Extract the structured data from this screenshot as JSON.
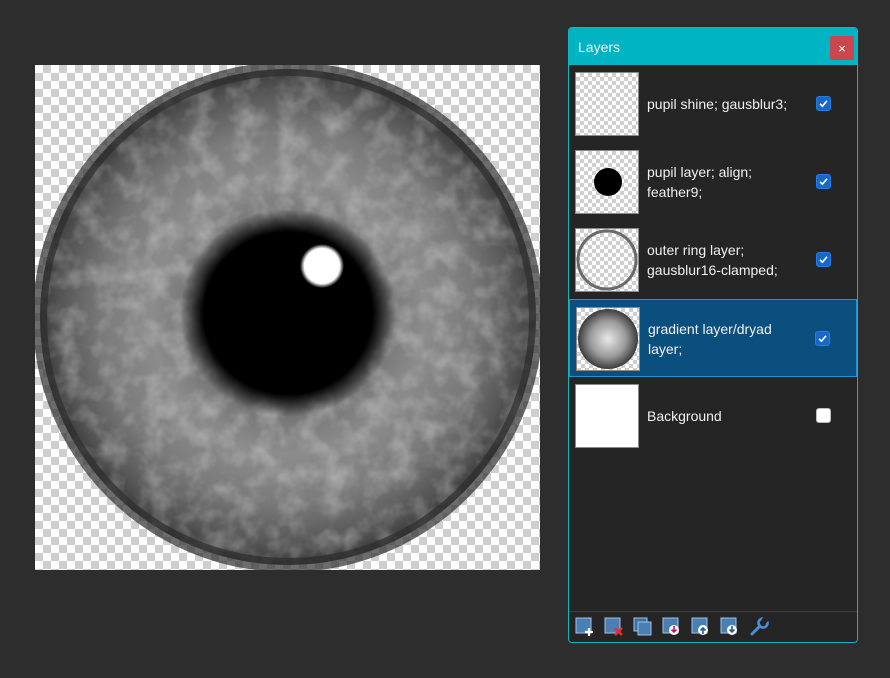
{
  "panel": {
    "title": "Layers",
    "close_glyph": "×",
    "accent_color": "#00b4c4",
    "selected_color": "#0b4f7f"
  },
  "layers": [
    {
      "label": "pupil shine; gausblur3;",
      "visible": true,
      "thumb": "transparent-shine"
    },
    {
      "label": "pupil layer; align; feather9;",
      "visible": true,
      "thumb": "pupil-dot"
    },
    {
      "label": "outer ring layer; gausblur16-clamped;",
      "visible": true,
      "thumb": "ring"
    },
    {
      "label": "gradient layer/dryad layer;",
      "visible": true,
      "selected": true,
      "thumb": "iris"
    },
    {
      "label": "Background",
      "visible": false,
      "thumb": "white"
    }
  ],
  "toolbar": [
    {
      "icon": "add-layer-icon"
    },
    {
      "icon": "delete-layer-icon"
    },
    {
      "icon": "duplicate-layer-icon"
    },
    {
      "icon": "merge-layer-down-icon"
    },
    {
      "icon": "move-layer-up-icon"
    },
    {
      "icon": "move-layer-down-icon"
    },
    {
      "icon": "layer-properties-icon"
    }
  ]
}
